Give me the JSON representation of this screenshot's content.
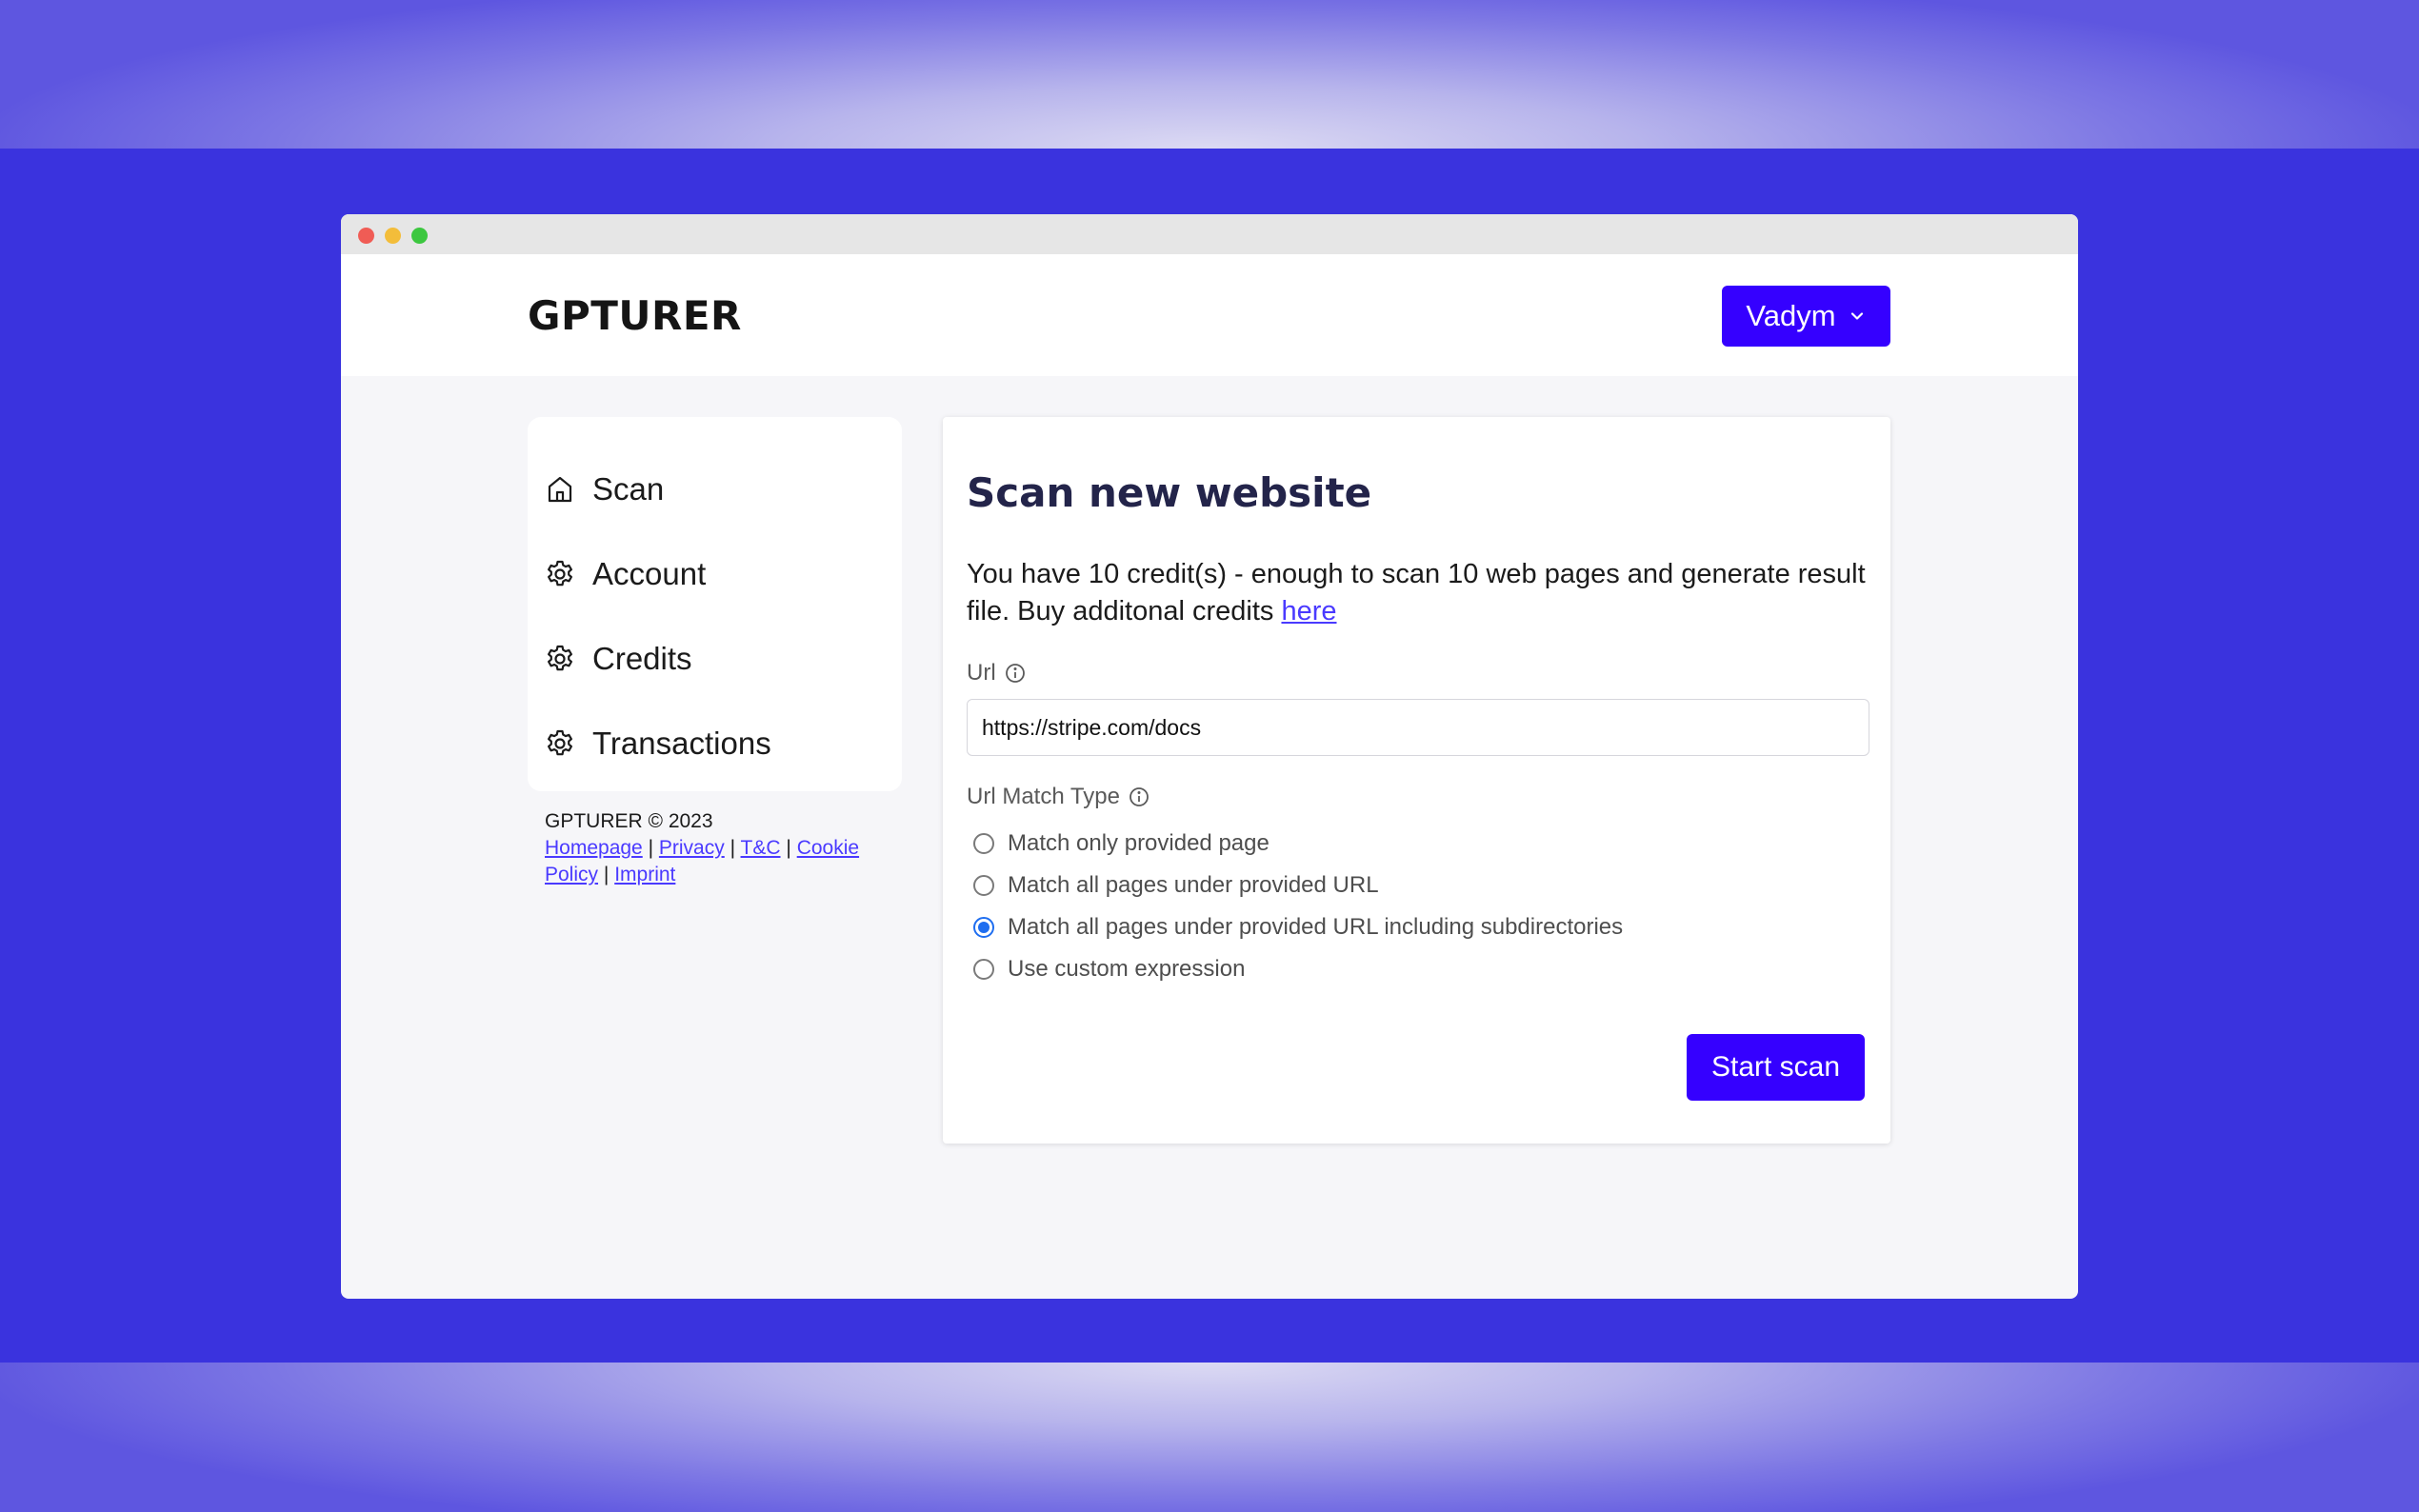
{
  "app": {
    "logo": "GPTURER",
    "user_menu_label": "Vadym"
  },
  "sidebar": {
    "items": [
      {
        "label": "Scan",
        "icon": "home-icon"
      },
      {
        "label": "Account",
        "icon": "gear-icon"
      },
      {
        "label": "Credits",
        "icon": "gear-icon"
      },
      {
        "label": "Transactions",
        "icon": "gear-icon"
      }
    ]
  },
  "footer": {
    "copyright": "GPTURER © 2023",
    "links": [
      "Homepage",
      "Privacy",
      "T&C",
      "Cookie Policy",
      "Imprint"
    ],
    "separator": "|"
  },
  "scan_form": {
    "title": "Scan new website",
    "description": "You have 10 credit(s) - enough to scan 10 web pages and generate result file. Buy additonal credits",
    "buy_link": "here",
    "url_label": "Url",
    "url_value": "https://stripe.com/docs",
    "match_type_label": "Url Match Type",
    "match_options": [
      {
        "label": "Match only provided page",
        "checked": false
      },
      {
        "label": "Match all pages under provided URL",
        "checked": false
      },
      {
        "label": "Match all pages under provided URL including subdirectories",
        "checked": true
      },
      {
        "label": "Use custom expression",
        "checked": false
      }
    ],
    "submit_label": "Start scan"
  },
  "colors": {
    "accent": "#3500ff",
    "background": "#3a33de",
    "link": "#4a3aff",
    "radio_checked": "#1f6ef0"
  }
}
